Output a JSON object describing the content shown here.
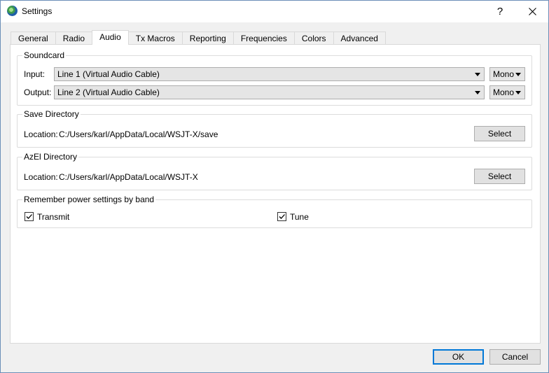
{
  "window": {
    "title": "Settings",
    "help_glyph": "?",
    "icon": "wsjtx-globe-icon"
  },
  "tabs": [
    {
      "label": "General",
      "active": false
    },
    {
      "label": "Radio",
      "active": false
    },
    {
      "label": "Audio",
      "active": true
    },
    {
      "label": "Tx Macros",
      "active": false
    },
    {
      "label": "Reporting",
      "active": false
    },
    {
      "label": "Frequencies",
      "active": false
    },
    {
      "label": "Colors",
      "active": false
    },
    {
      "label": "Advanced",
      "active": false
    }
  ],
  "soundcard": {
    "title": "Soundcard",
    "input_label": "Input:",
    "input_value": "Line 1 (Virtual Audio Cable)",
    "input_channel": "Mono",
    "output_label": "Output:",
    "output_value": "Line 2 (Virtual Audio Cable)",
    "output_channel": "Mono"
  },
  "save_directory": {
    "title": "Save Directory",
    "location_label": "Location:",
    "location_value": "C:/Users/karl/AppData/Local/WSJT-X/save",
    "select_label": "Select"
  },
  "azel_directory": {
    "title": "AzEl Directory",
    "location_label": "Location:",
    "location_value": "C:/Users/karl/AppData/Local/WSJT-X",
    "select_label": "Select"
  },
  "power": {
    "title": "Remember power settings by band",
    "transmit_label": "Transmit",
    "transmit_checked": true,
    "tune_label": "Tune",
    "tune_checked": true
  },
  "footer": {
    "ok_label": "OK",
    "cancel_label": "Cancel"
  },
  "colors": {
    "accent": "#0078d7",
    "window_border": "#6b8fb8"
  }
}
